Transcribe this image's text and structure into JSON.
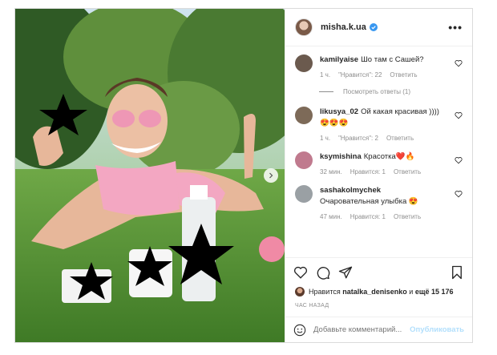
{
  "post": {
    "username": "misha.k.ua",
    "more_label": "•••"
  },
  "comments": [
    {
      "user": "kamilyaise",
      "text": "Шо там с Сашей?",
      "time": "1 ч.",
      "likes": "\"Нравится\": 22",
      "reply": "Ответить",
      "avatar_color": "#6b5a4e"
    },
    {
      "user": "likusya_02",
      "text": "Ой какая красивая ))))",
      "emoji": "😍😍😍",
      "time": "1 ч.",
      "likes": "\"Нравится\": 2",
      "reply": "Ответить",
      "avatar_color": "#7d6a58"
    },
    {
      "user": "ksymishina",
      "text": "Красотка❤️🔥",
      "time": "32 мин.",
      "likes": "Нравится: 1",
      "reply": "Ответить",
      "avatar_color": "#c07a8e"
    },
    {
      "user": "sashakolmychek",
      "text": "Очаровательная улыбка 😍",
      "time": "47 мин.",
      "likes": "Нравится: 1",
      "reply": "Ответить",
      "avatar_color": "#9aa0a4"
    }
  ],
  "view_replies": "Посмотреть ответы (1)",
  "likes_line": {
    "prefix": "Нравится",
    "user": "natalka_denisenko",
    "middle": "и",
    "count": "ещё 15 176"
  },
  "time_ago": "ЧАС НАЗАД",
  "add_comment": {
    "placeholder": "Добавьте комментарий...",
    "publish": "Опубликовать"
  },
  "colors": {
    "verified": "#3897f0",
    "publish_disabled": "#b2dffc",
    "meta_gray": "#8e8e8e"
  }
}
